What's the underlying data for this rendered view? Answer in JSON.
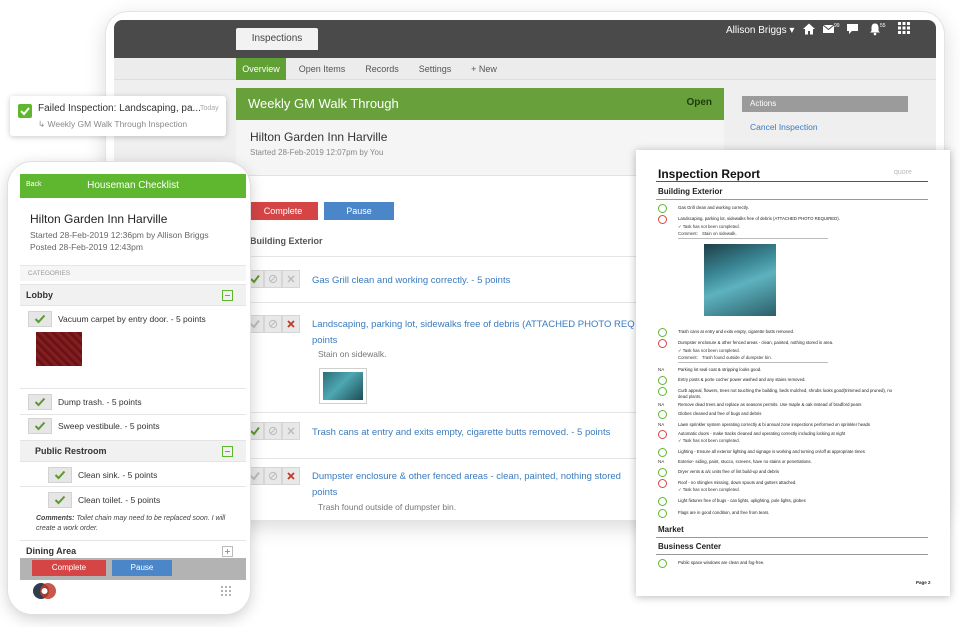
{
  "desktop": {
    "app_tab": "Inspections",
    "user_name": "Allison Briggs ▾",
    "badges": {
      "mail": "99",
      "notifications": "55"
    },
    "nav_tabs": [
      "Overview",
      "Open Items",
      "Records",
      "Settings",
      "+ New"
    ],
    "inspection": {
      "title": "Weekly GM Walk Through",
      "status": "Open",
      "location": "Hilton Garden Inn Harville",
      "started": "Started 28-Feb-2019 12:07pm by You",
      "complete_label": "Complete",
      "pause_label": "Pause",
      "section": "Building Exterior",
      "items": [
        {
          "text": "Gas Grill clean and working correctly. - 5 points",
          "state": "pass",
          "note": ""
        },
        {
          "text": "Landscaping, parking lot, sidewalks free of debris (ATTACHED PHOTO REQ",
          "text2": "points",
          "state": "fail",
          "note": "Stain on sidewalk."
        },
        {
          "text": "Trash cans at entry and exits empty, cigarette butts removed. - 5 points",
          "state": "pass",
          "note": ""
        },
        {
          "text": "Dumpster enclosure & other fenced areas - clean, painted, nothing stored",
          "text2": "points",
          "state": "fail",
          "note": "Trash found outside of dumpster bin."
        }
      ]
    },
    "actions": {
      "heading": "Actions",
      "cancel": "Cancel Inspection"
    }
  },
  "notification": {
    "title": "Failed Inspection: Landscaping, pa...",
    "subtitle": "↳ Weekly GM Walk Through Inspection",
    "time": "Today"
  },
  "mobile": {
    "back": "Back",
    "title": "Houseman Checklist",
    "location": "Hilton Garden Inn Harville",
    "started": "Started 28-Feb-2019 12:36pm by Allison Briggs",
    "posted": "Posted 28-Feb-2019 12:43pm",
    "categories_label": "CATEGORIES",
    "lobby": {
      "label": "Lobby",
      "items": [
        "Vacuum carpet by entry door. - 5 points",
        "Dump trash. - 5 points",
        "Sweep vestibule. - 5 points"
      ]
    },
    "restroom": {
      "label": "Public Restroom",
      "items": [
        "Clean sink. - 5 points",
        "Clean toilet. - 5 points"
      ],
      "comment_label": "Comments:",
      "comment": " Toilet chain may need to be replaced soon. I will create a work order."
    },
    "dining": {
      "label": "Dining Area"
    },
    "complete_label": "Complete",
    "pause_label": "Pause"
  },
  "report": {
    "title": "Inspection Report",
    "logo": "quore",
    "sections": {
      "building": "Building Exterior",
      "market": "Market",
      "business": "Business Center"
    },
    "rows": [
      {
        "status": "ok",
        "text": "Gas Grill clean and working correctly."
      },
      {
        "status": "x",
        "text": "Landscaping, parking lot, sidewalks free of debris (ATTACHED PHOTO REQUIRED)."
      },
      {
        "status": "ok",
        "text": "Trash cans at entry and exits empty, cigarette butts removed."
      },
      {
        "status": "x",
        "text": "Dumpster enclosure & other fenced areas - clean, painted, nothing stored in area."
      },
      {
        "status": "NA",
        "text": "Parking lot seal coat & stripping looks good."
      },
      {
        "status": "ok",
        "text": "Entry posts & porte cocher power washed and any stains removed."
      },
      {
        "status": "ok",
        "text": "Curb appeal, flowers, trees not touching the building, beds mulched, shrubs looks good(trimmed and pruned), no"
      },
      {
        "status": "NA",
        "text": "Remove dead trees and replace as seasons permits. Use maple & oak instead of bradford pears"
      },
      {
        "status": "ok",
        "text": "Globes cleaned and free of bugs and debris"
      },
      {
        "status": "NA",
        "text": "Lawn sprinkler system operating correctly & bi annual zone inspections performed on sprinkler heads"
      },
      {
        "status": "x",
        "text": "Automatic doors - make tracks cleaned and operating correctly including locking at night"
      },
      {
        "status": "ok",
        "text": "Lighting - Ensure all exterior lighting and signage is working and turning on/off at appropriate times"
      },
      {
        "status": "NA",
        "text": "Exterior- siding, paint, stucco, screens, have no stains or penetrations."
      },
      {
        "status": "ok",
        "text": "Dryer vents & a/c units free of lint build-up and debris"
      },
      {
        "status": "x",
        "text": "Roof - no shingles missing, down spouts and gutters attached."
      },
      {
        "status": "ok",
        "text": "Light fixtures free of bugs - can lights, uplighting, pole lights, globes"
      },
      {
        "status": "ok",
        "text": "Flags are in good condition, and free from tears."
      },
      {
        "status": "ok",
        "text": "Public space windows are clean and fog-free."
      }
    ],
    "extra": {
      "dead_plants": "dead plants.",
      "task_not_completed": "✓ Task has not been completed.",
      "comment_label": "Comment:",
      "comment_stain": "Stain on sidewalk.",
      "comment_trash": "Trash found outside of dumpster bin."
    },
    "page": "Page 2"
  },
  "colors": {
    "accent_green": "#61a035",
    "complete_red": "#d64545",
    "pause_blue": "#4a86c8",
    "link_blue": "#3a7bbf"
  },
  "icons": [
    "home-icon",
    "mail-icon",
    "chat-icon",
    "bell-icon",
    "grid-icon",
    "check-icon",
    "block-icon",
    "x-icon",
    "minus-box-icon",
    "plus-box-icon"
  ]
}
